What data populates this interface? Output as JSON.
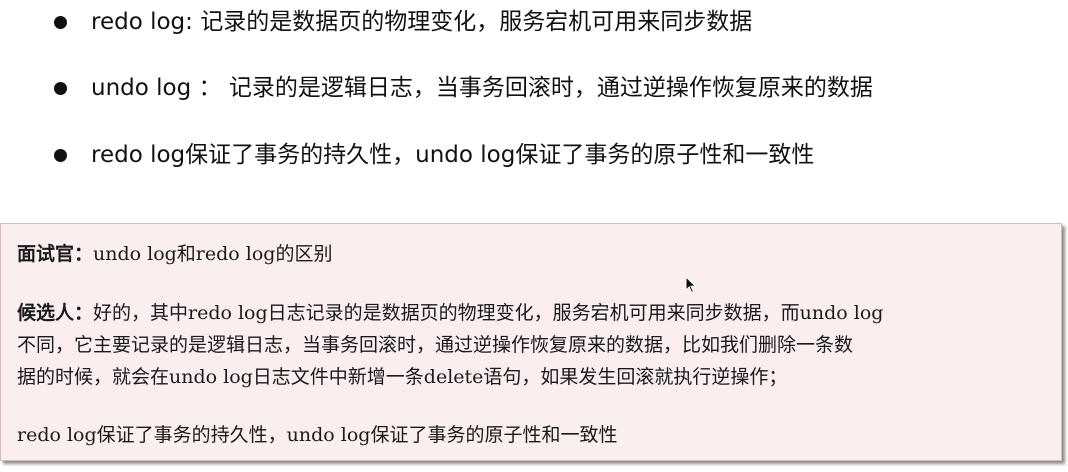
{
  "bullets": [
    "redo log: 记录的是数据页的物理变化，服务宕机可用来同步数据",
    "undo log ： 记录的是逻辑日志，当事务回滚时，通过逆操作恢复原来的数据",
    "redo log保证了事务的持久性，undo log保证了事务的原子性和一致性"
  ],
  "dialog": {
    "interviewer_label": "面试官：",
    "interviewer_text": "undo log和redo log的区别",
    "candidate_label": "候选人：",
    "candidate_line1": "好的，其中redo log日志记录的是数据页的物理变化，服务宕机可用来同步数据，而undo log",
    "candidate_line2": "不同，它主要记录的是逻辑日志，当事务回滚时，通过逆操作恢复原来的数据，比如我们删除一条数",
    "candidate_line3": "据的时候，就会在undo log日志文件中新增一条delete语句，如果发生回滚就执行逆操作；",
    "summary": "redo log保证了事务的持久性，undo log保证了事务的原子性和一致性"
  },
  "colors": {
    "note_background": "#fbeeee",
    "text": "#111111"
  }
}
